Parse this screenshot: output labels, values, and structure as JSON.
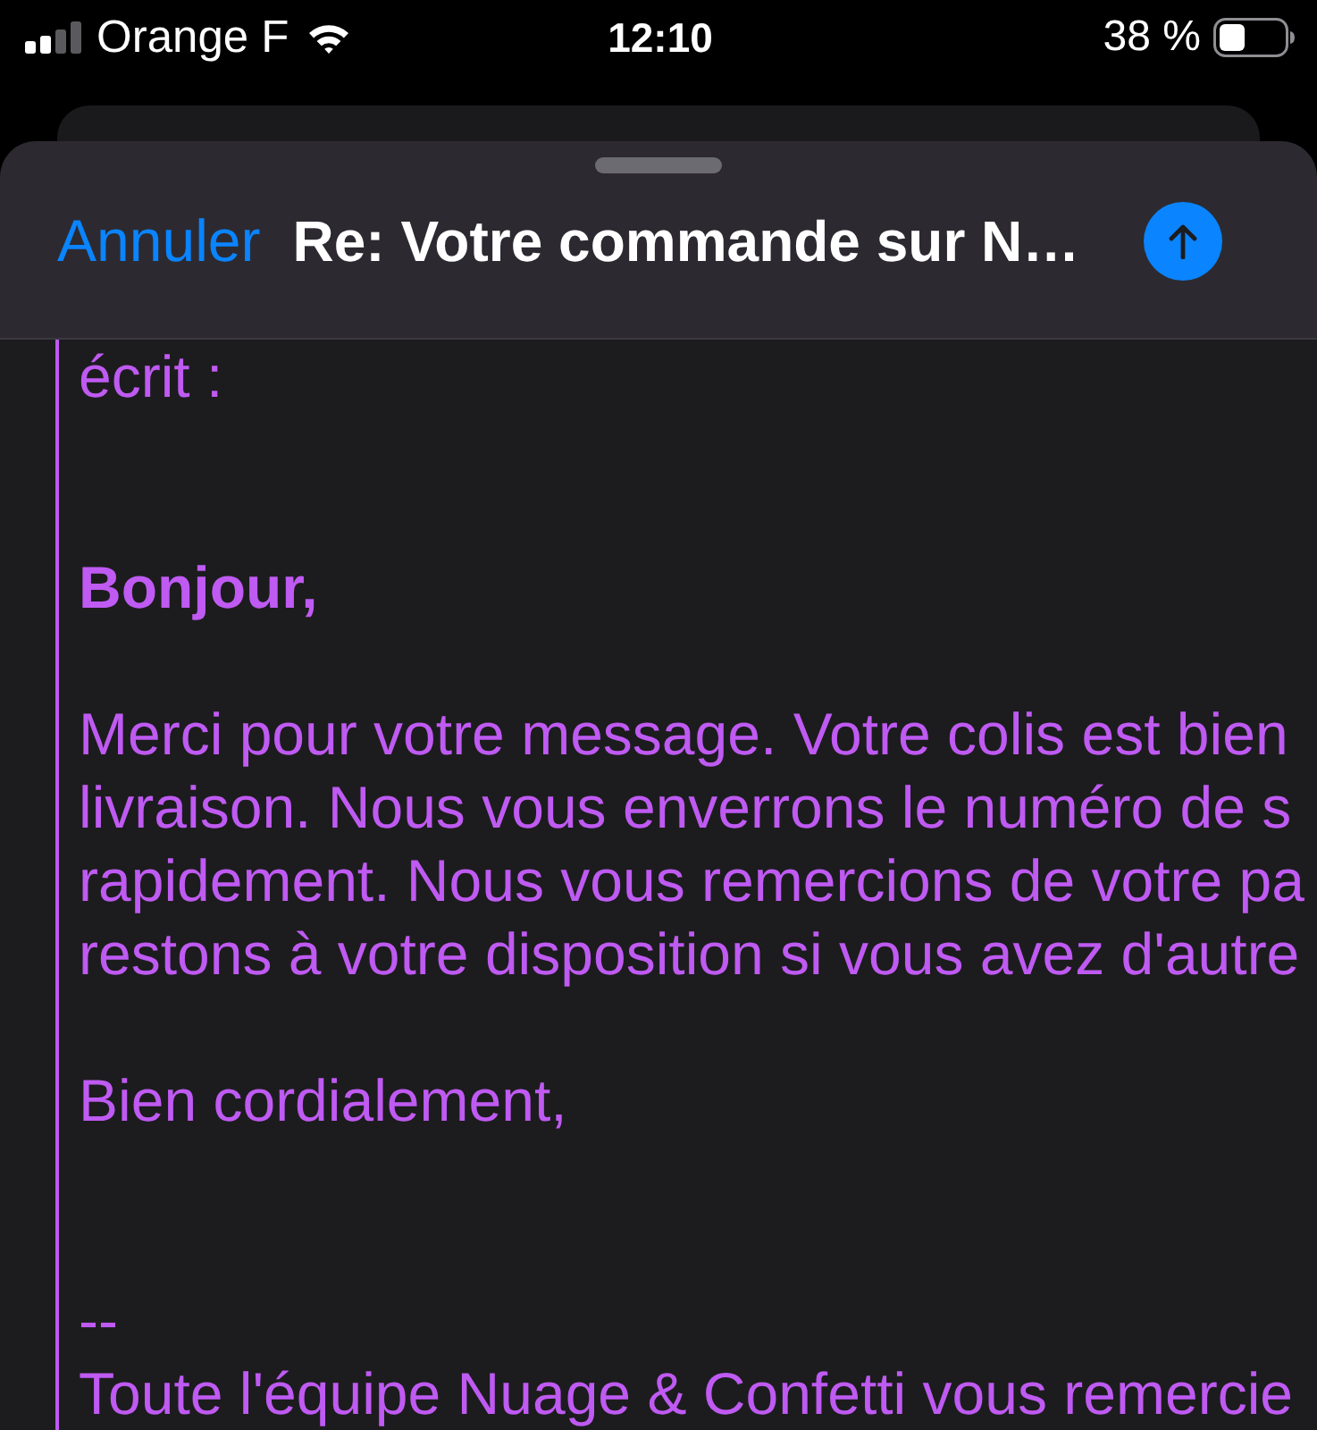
{
  "status_bar": {
    "carrier": "Orange F",
    "time": "12:10",
    "battery": "38 %"
  },
  "compose_sheet": {
    "cancel_label": "Annuler",
    "subject": "Re: Votre commande sur N…"
  },
  "quoted_message": [
    {
      "kind": "attribution",
      "lines": [
        "écrit :"
      ]
    },
    {
      "kind": "greeting",
      "lines": [
        "Bonjour,"
      ]
    },
    {
      "kind": "paragraph",
      "lines": [
        "Merci pour votre message. Votre colis est bien",
        "livraison. Nous vous enverrons le numéro de s",
        "rapidement. Nous vous remercions de votre pa",
        "restons à votre disposition si vous avez d'autre"
      ]
    },
    {
      "kind": "closing",
      "lines": [
        "Bien cordialement,"
      ]
    },
    {
      "kind": "signature",
      "lines": [
        "--",
        "Toute l'équipe Nuage & Confetti vous remercie"
      ]
    }
  ]
}
